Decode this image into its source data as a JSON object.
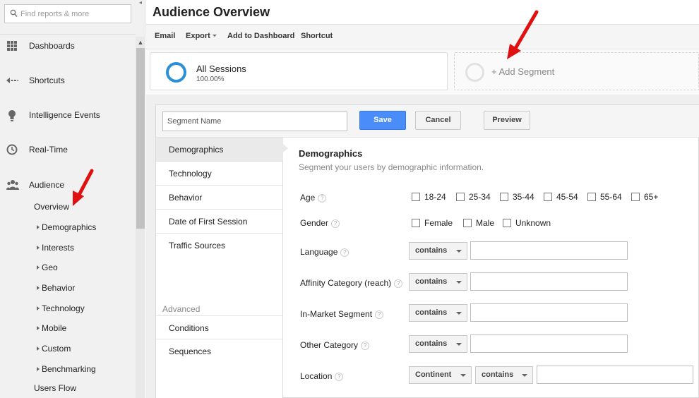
{
  "sidebar": {
    "search_placeholder": "Find reports & more",
    "nav": [
      {
        "label": "Dashboards",
        "icon": "grid-icon"
      },
      {
        "label": "Shortcuts",
        "icon": "shortcut-arrow-icon"
      },
      {
        "label": "Intelligence Events",
        "icon": "lightbulb-icon"
      },
      {
        "label": "Real-Time",
        "icon": "clock-icon"
      },
      {
        "label": "Audience",
        "icon": "people-icon"
      }
    ],
    "audience_items": {
      "overview": "Overview",
      "demographics": "Demographics",
      "interests": "Interests",
      "geo": "Geo",
      "behavior": "Behavior",
      "technology": "Technology",
      "mobile": "Mobile",
      "custom": "Custom",
      "benchmarking": "Benchmarking",
      "users_flow": "Users Flow"
    }
  },
  "header": {
    "title": "Audience Overview",
    "toolbar": {
      "email": "Email",
      "export": "Export",
      "add_to_dashboard": "Add to Dashboard",
      "shortcut": "Shortcut"
    }
  },
  "segments": {
    "all_sessions": {
      "name": "All Sessions",
      "percent": "100.00%"
    },
    "add_segment": "+ Add Segment"
  },
  "builder": {
    "segment_name_placeholder": "Segment Name",
    "save": "Save",
    "cancel": "Cancel",
    "preview": "Preview",
    "menu": {
      "demographics": "Demographics",
      "technology": "Technology",
      "behavior": "Behavior",
      "date_of_first_session": "Date of First Session",
      "traffic_sources": "Traffic Sources",
      "advanced_label": "Advanced",
      "conditions": "Conditions",
      "sequences": "Sequences"
    },
    "form": {
      "title": "Demographics",
      "subtitle": "Segment your users by demographic information.",
      "age_label": "Age",
      "ages": [
        "18-24",
        "25-34",
        "35-44",
        "45-54",
        "55-64",
        "65+"
      ],
      "gender_label": "Gender",
      "genders": [
        "Female",
        "Male",
        "Unknown"
      ],
      "language_label": "Language",
      "affinity_label": "Affinity Category (reach)",
      "inmarket_label": "In-Market Segment",
      "other_label": "Other Category",
      "location_label": "Location",
      "contains": "contains",
      "continent": "Continent",
      "help": "?"
    }
  },
  "colors": {
    "accent_blue": "#4b8df8",
    "ring_blue": "#2a90d8",
    "annotation_red": "#e01010"
  }
}
